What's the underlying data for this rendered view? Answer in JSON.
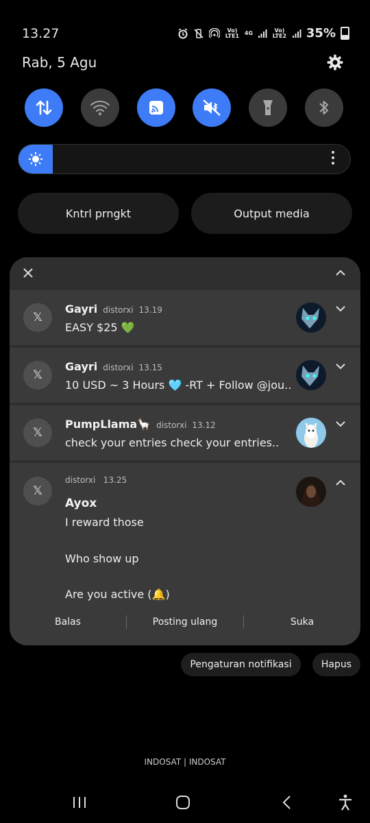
{
  "status_bar": {
    "time": "13.27",
    "sim1": "Vo) LTE1",
    "sim2": "Vo) LTE2",
    "network_4g": "4G",
    "battery": "35%"
  },
  "header": {
    "date": "Rab, 5 Agu",
    "settings_icon": "gear-icon"
  },
  "toggles": [
    {
      "name": "mobile-data",
      "icon": "data-arrows-icon",
      "on": true
    },
    {
      "name": "wifi",
      "icon": "wifi-icon",
      "on": false
    },
    {
      "name": "cast",
      "icon": "cast-icon",
      "on": true
    },
    {
      "name": "mute",
      "icon": "mute-icon",
      "on": true
    },
    {
      "name": "flashlight",
      "icon": "flashlight-icon",
      "on": false
    },
    {
      "name": "bluetooth",
      "icon": "bluetooth-icon",
      "on": false
    }
  ],
  "brightness": {
    "level": 0.1
  },
  "pills": {
    "device_control": "Kntrl prngkt",
    "media_output": "Output media"
  },
  "panel": {
    "app_icon": "X",
    "notifications": [
      {
        "title": "Gayri",
        "account": "distorxi",
        "time": "13.19",
        "body": "EASY $25 💚"
      },
      {
        "title": "Gayri",
        "account": "distorxi",
        "time": "13.15",
        "body": "10 USD ~ 3 Hours 🩵  -RT + Follow @jou.."
      },
      {
        "title": "PumpLlama🦙",
        "account": "distorxi",
        "time": "13.12",
        "body": "check your entries check your entries.."
      },
      {
        "account": "distorxi",
        "time": "13.25",
        "title": "Ayox",
        "lines": [
          "I reward those",
          "Who show up",
          "Are you active (🔔)"
        ]
      }
    ],
    "actions": {
      "reply": "Balas",
      "repost": "Posting ulang",
      "like": "Suka"
    }
  },
  "chips": {
    "notif_settings": "Pengaturan notifikasi",
    "clear": "Hapus"
  },
  "carrier": "INDOSAT | INDOSAT",
  "colors": {
    "accent": "#3e7bf6",
    "panel": "#2f2f2f",
    "card": "#3a3a3a"
  }
}
